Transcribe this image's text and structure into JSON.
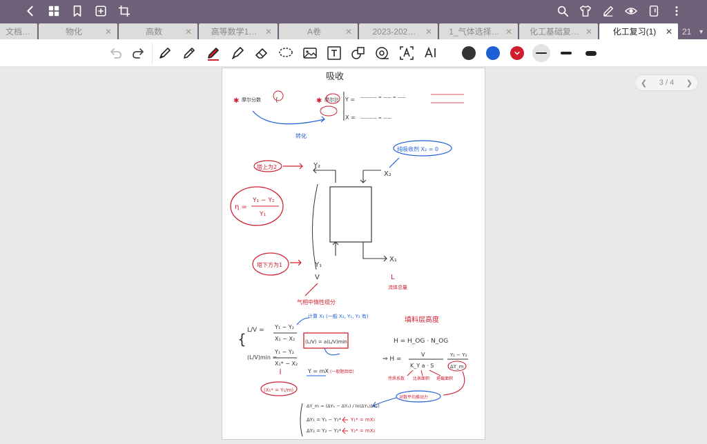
{
  "tabs": [
    {
      "label": "文档…",
      "active": false
    },
    {
      "label": "物化",
      "active": false
    },
    {
      "label": "高数",
      "active": false
    },
    {
      "label": "高等数学1…",
      "active": false
    },
    {
      "label": "A卷",
      "active": false
    },
    {
      "label": "2023-202…",
      "active": false
    },
    {
      "label": "1_气体选择…",
      "active": false
    },
    {
      "label": "化工基础复…",
      "active": false
    },
    {
      "label": "化工复习(1)",
      "active": true
    }
  ],
  "tab_overflow": "21",
  "close_glyph": "✕",
  "pager": {
    "text": "3 / 4"
  },
  "colors": {
    "topbar": "#6f6079",
    "black": "#333333",
    "blue": "#1f5fd6",
    "red": "#d01d2e"
  },
  "note": {
    "title": "吸收",
    "y2": "Y₂",
    "x2": "X₂",
    "y1": "Y₁",
    "x1": "X₁",
    "v": "V",
    "l": "L",
    "top_label": "塔上为2",
    "bottom_label": "塔下方为1",
    "pure_absorbent": "纯吸收剂 X₂ = 0",
    "inert_gas": "气相中惰性组分",
    "liquid_flow": "流体总量",
    "eta_lhs": "η =",
    "eta_num": "Y₁ − Y₂",
    "eta_den": "Y₁",
    "height_label": "填料层高度",
    "h_eq1": "H = H_OG · N_OG",
    "h_eq2": "⇒ H =",
    "h_num": "V",
    "h_den": "K_Y a · S",
    "h_frac2_num": "Y₁ − Y₂",
    "h_frac2_den": "ΔY_m",
    "lv_lhs": "L/V =",
    "lv_num": "Y₁ − Y₂",
    "lv_den": "X₁ − X₂",
    "lvmin_lhs": "(L/V)min =",
    "lvmin_num": "Y₁ − Y₂",
    "lvmin_den": "X₁* − X₂",
    "ratio": "(L/V) = a(L/V)min",
    "calc_note": "计算 X₁ (一般 X₂, Y₁, Y₂ 有)",
    "eq_line": "Y = mX",
    "x1star": "(X₁* = Y₁/m)",
    "mass_transfer": "传质系数",
    "area": "比表面积",
    "cross_section": "塔截面积",
    "log_mean": "对数平均推动力",
    "dym": "ΔY_m = (ΔY₁ − ΔY₂) / ln(ΔY₁/ΔY₂)",
    "dy1": "ΔY₁ = Y₁ − Y₁*",
    "dy2": "ΔY₂ = Y₂ − Y₂*",
    "y1star": "Y₁* = mX₁",
    "y2star": "Y₂* = mX₂",
    "fraction_title": "摩尔分数",
    "ratio_title": "摩尔比",
    "convert": "转化"
  }
}
